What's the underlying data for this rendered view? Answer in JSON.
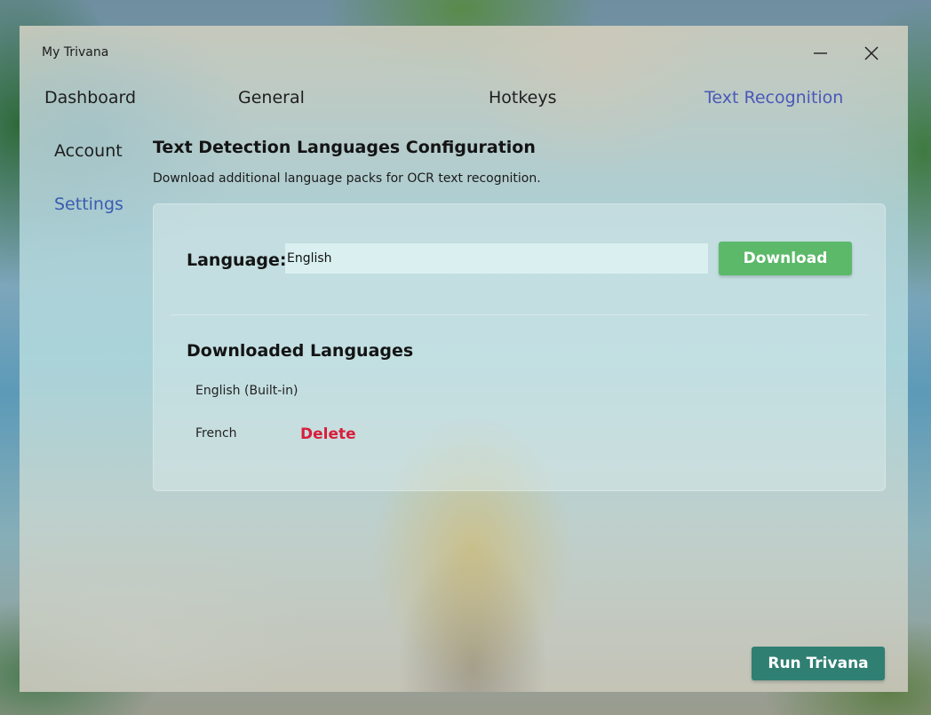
{
  "window": {
    "title": "My Trivana",
    "minimize_icon": "minimize-icon",
    "close_icon": "close-icon"
  },
  "topnav": {
    "items": [
      {
        "label": "Dashboard",
        "active": false
      },
      {
        "label": "General",
        "active": false
      },
      {
        "label": "Hotkeys",
        "active": false
      },
      {
        "label": "Text Recognition",
        "active": true
      }
    ]
  },
  "sidenav": {
    "items": [
      {
        "label": "Account",
        "active": false
      },
      {
        "label": "Settings",
        "active": true
      }
    ]
  },
  "content": {
    "title": "Text Detection Languages Configuration",
    "subtitle": "Download additional language packs for OCR text recognition."
  },
  "language_form": {
    "label": "Language:",
    "value": "English",
    "download_label": "Download"
  },
  "downloaded": {
    "title": "Downloaded Languages",
    "languages": [
      {
        "name": "English (Built-in)",
        "deletable": false
      },
      {
        "name": "French",
        "deletable": true,
        "delete_label": "Delete"
      }
    ]
  },
  "footer": {
    "run_label": "Run Trivana"
  },
  "colors": {
    "active_nav": "#4a58b8",
    "active_side": "#3b5bb0",
    "download_button": "#5cb96a",
    "delete_text": "#d81e3c",
    "run_button": "#2f7f72"
  }
}
